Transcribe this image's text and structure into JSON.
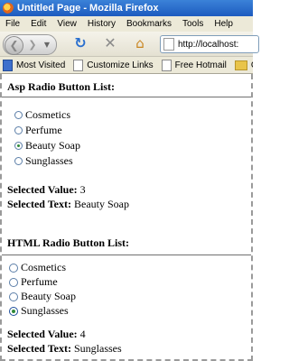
{
  "window": {
    "title": "Untitled Page - Mozilla Firefox"
  },
  "menu": [
    "File",
    "Edit",
    "View",
    "History",
    "Bookmarks",
    "Tools",
    "Help"
  ],
  "toolbar": {
    "url": "http://localhost:"
  },
  "bookmarks": [
    {
      "label": "Most Visited",
      "icon": "most-visited-icon"
    },
    {
      "label": "Customize Links",
      "icon": "page-icon"
    },
    {
      "label": "Free Hotmail",
      "icon": "page-icon"
    },
    {
      "label": "G",
      "icon": "folder-icon"
    }
  ],
  "asp_section": {
    "title": "Asp Radio Button List:",
    "options": [
      "Cosmetics",
      "Perfume",
      "Beauty Soap",
      "Sunglasses"
    ],
    "selected_index": 2,
    "selected_value_label": "Selected Value:",
    "selected_value": "3",
    "selected_text_label": "Selected Text:",
    "selected_text": "Beauty Soap"
  },
  "html_section": {
    "title": "HTML Radio Button List:",
    "options": [
      "Cosmetics",
      "Perfume",
      "Beauty Soap",
      "Sunglasses"
    ],
    "selected_index": 3,
    "selected_value_label": "Selected Value:",
    "selected_value": "4",
    "selected_text_label": "Selected Text:",
    "selected_text": "Sunglasses"
  }
}
